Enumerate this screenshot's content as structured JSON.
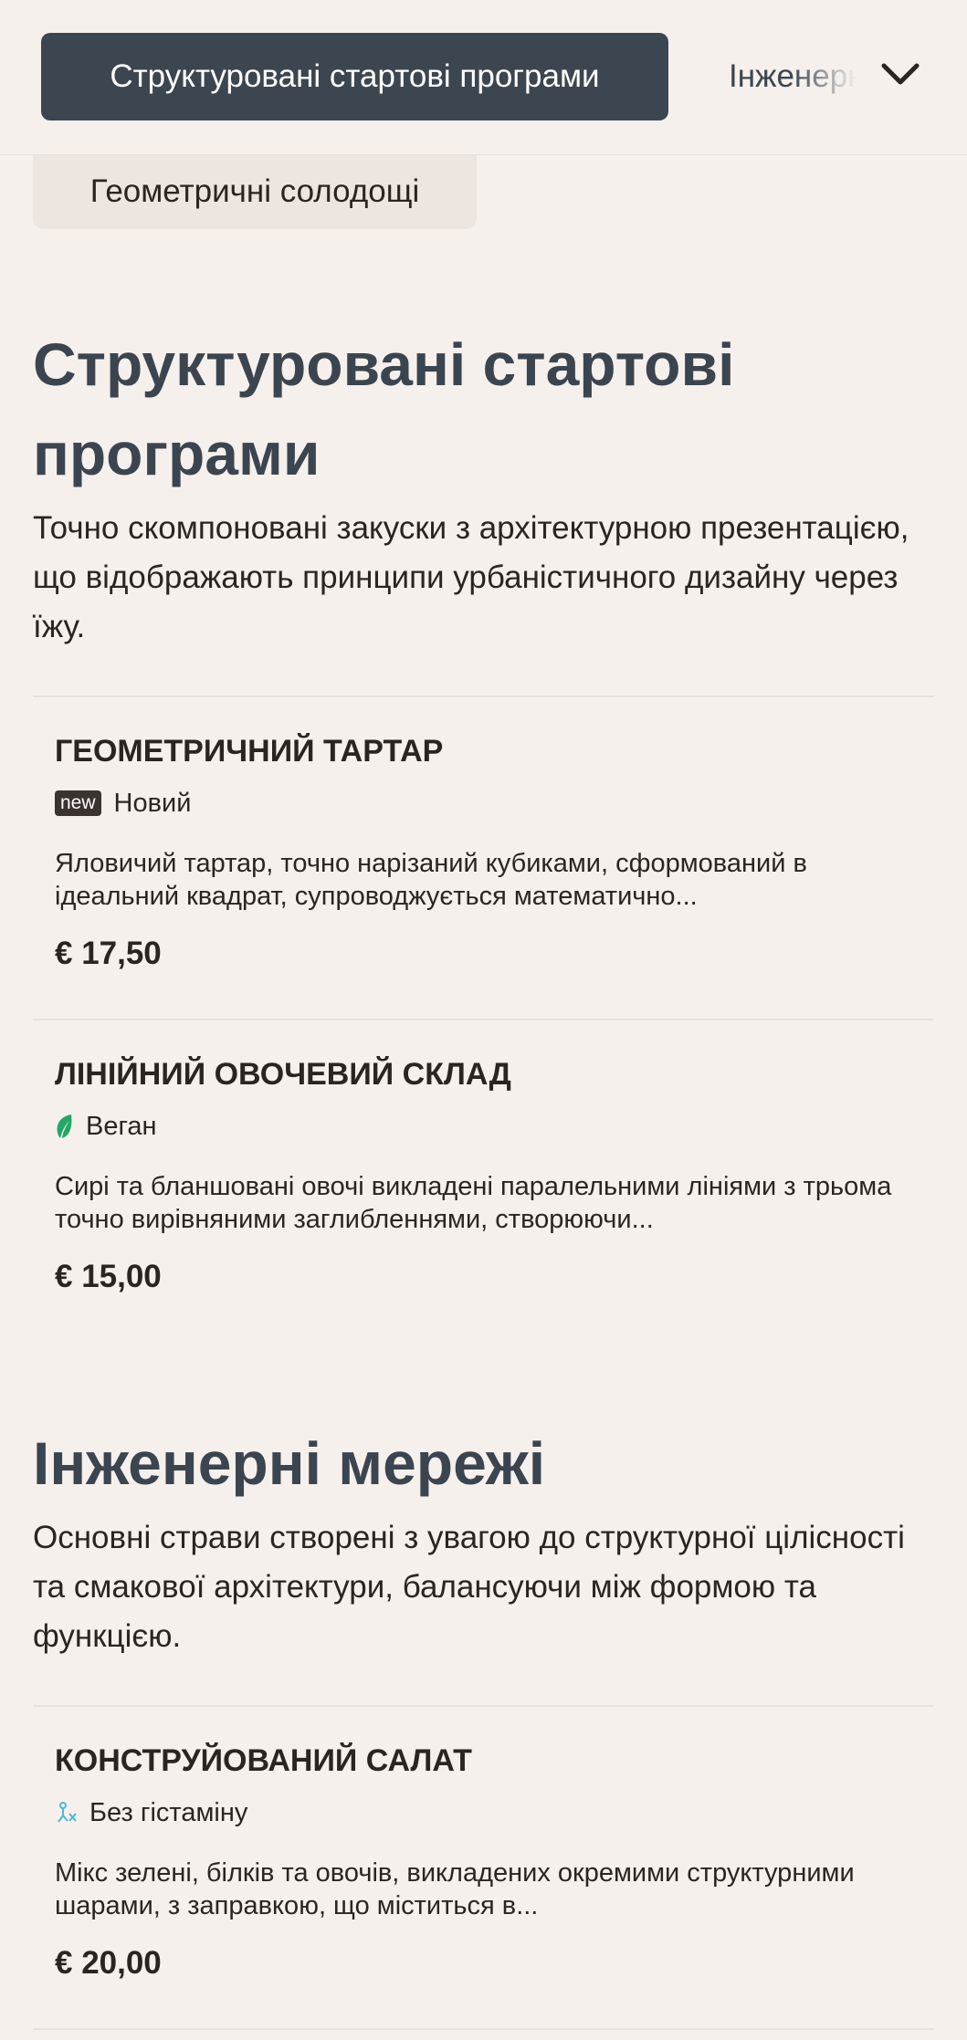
{
  "header": {
    "active_tab": "Структуровані стартові програми",
    "next_tab": "Інженерні мережі"
  },
  "chip": {
    "label": "Геометричні солодощі"
  },
  "sections": [
    {
      "title": "Структуровані стартові програми",
      "description": "Точно скомпоновані закуски з архітектурною презентацією, що відображають принципи урбаністичного дизайну через їжу.",
      "items": [
        {
          "name": "ГЕОМЕТРИЧНИЙ ТАРТАР",
          "badge": "new",
          "tag": "Новий",
          "description": "Яловичий тартар, точно нарізаний кубиками, сформований в ідеальний квадрат, супроводжується математично...",
          "price": "€ 17,50"
        },
        {
          "name": "ЛІНІЙНИЙ ОВОЧЕВИЙ СКЛАД",
          "tag": "Веган",
          "tag_icon": "leaf-icon",
          "description": "Сирі та бланшовані овочі викладені паралельними лініями з трьома точно вирівняними заглибленнями, створюючи...",
          "price": "€ 15,00"
        }
      ]
    },
    {
      "title": "Інженерні мережі",
      "description": "Основні страви створені з увагою до структурної цілісності та смакової архітектури, балансуючи між формою та функцією.",
      "items": [
        {
          "name": "КОНСТРУЙОВАНИЙ САЛАТ",
          "tag": "Без гістаміну",
          "tag_icon": "histamine-free-icon",
          "description": "Мікс зелені, білків та овочів, викладених окремими структурними шарами, з заправкою, що міститься в...",
          "price": "€ 20,00"
        }
      ]
    }
  ],
  "colors": {
    "background": "#f6f0ec",
    "active_tab": "#3c4650",
    "title": "#3b4550",
    "vegan": "#22a866",
    "histamine": "#4cb8d8"
  }
}
